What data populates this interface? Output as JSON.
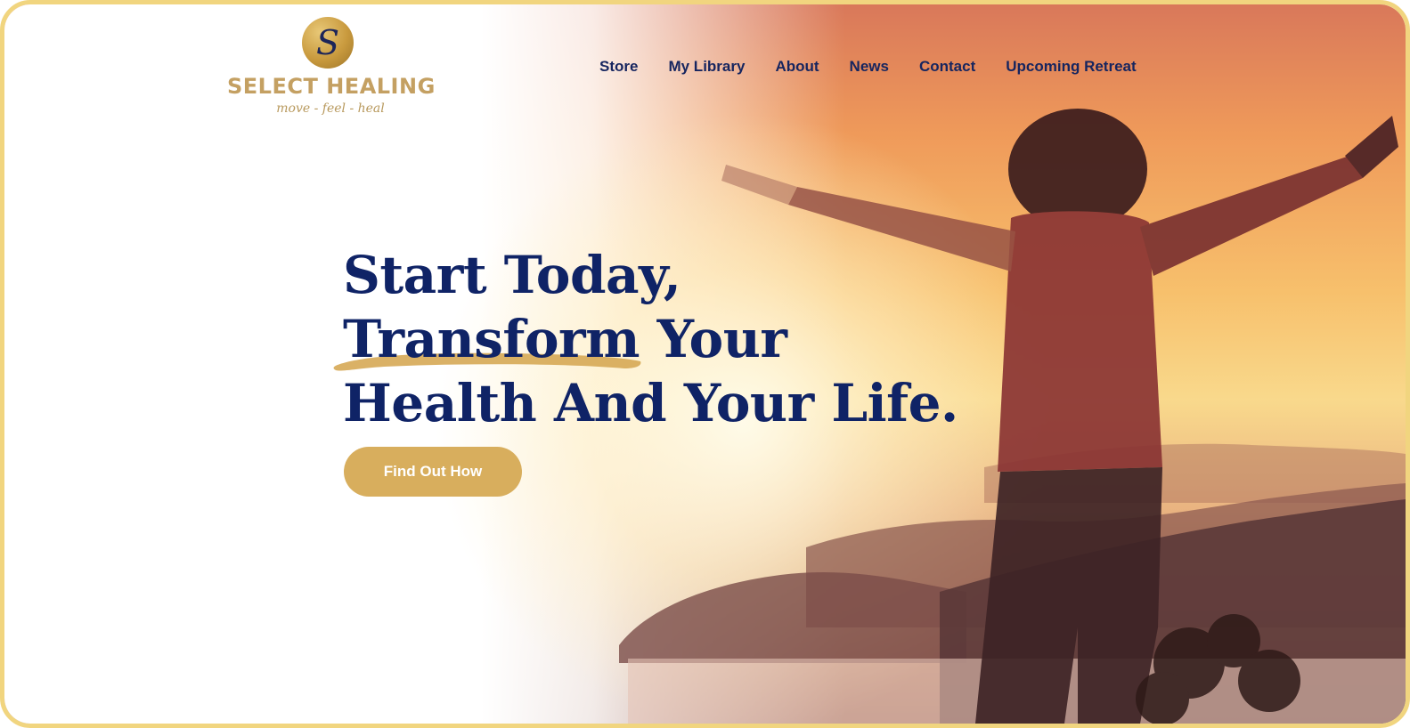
{
  "brand": {
    "logo_letter": "S",
    "name": "SELECT HEALING",
    "tagline": "move - feel - heal",
    "gold": "#c4a062"
  },
  "nav": {
    "items": [
      {
        "label": "Store"
      },
      {
        "label": "My Library"
      },
      {
        "label": "About"
      },
      {
        "label": "News"
      },
      {
        "label": "Contact"
      },
      {
        "label": "Upcoming Retreat"
      }
    ],
    "color": "#16255f"
  },
  "hero": {
    "headline_line1": "Start Today,",
    "headline_line2": "Transform Your",
    "headline_line3": "Health And Your Life.",
    "cta_label": "Find Out How",
    "headline_color": "#0f2366",
    "cta_color": "#d8ae5d",
    "image": "silhouette-arms-raised-sunset-mountains"
  },
  "frame_border_color": "#f1d57f"
}
